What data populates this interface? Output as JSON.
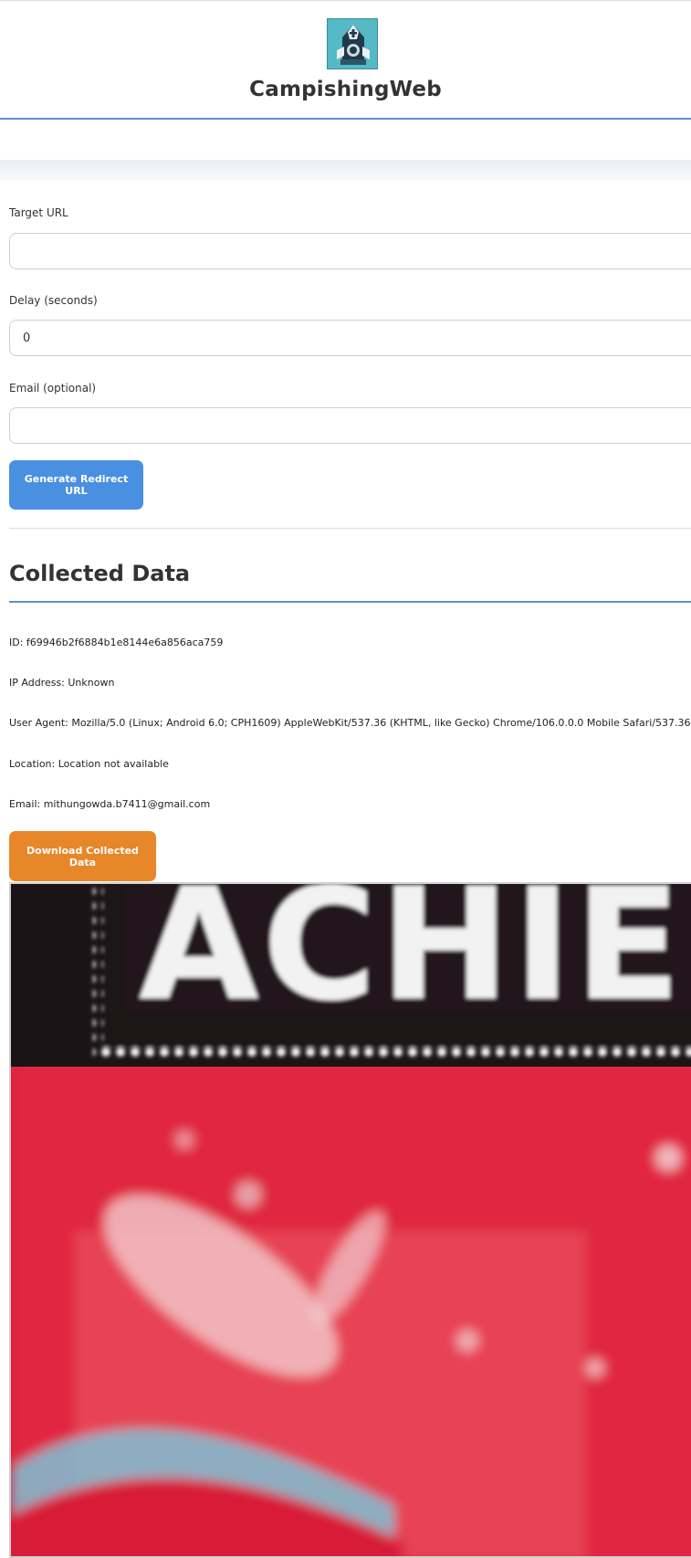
{
  "header": {
    "title": "CampishingWeb",
    "logo_icon": "hooded-hacker-logo"
  },
  "form": {
    "target_url_label": "Target URL",
    "target_url_value": "",
    "delay_label": "Delay (seconds)",
    "delay_value": "0",
    "email_label": "Email (optional)",
    "email_value": "",
    "generate_button": "Generate Redirect URL"
  },
  "collected": {
    "title": "Collected Data",
    "id_line": "ID: f69946b2f6884b1e8144e6a856aca759",
    "ip_line": "IP Address: Unknown",
    "user_agent_line": "User Agent: Mozilla/5.0 (Linux; Android 6.0; CPH1609) AppleWebKit/537.36 (KHTML, like Gecko) Chrome/106.0.0.0 Mobile Safari/537.36",
    "location_line": "Location: Location not available",
    "email_line": "Email: mithungowda.b7411@gmail.com",
    "download_button": "Download Collected Data",
    "photo_text": "ACHIE"
  },
  "colors": {
    "accent": "#4a90e2",
    "rule": "#5b93c9",
    "download": "#e8862a"
  }
}
